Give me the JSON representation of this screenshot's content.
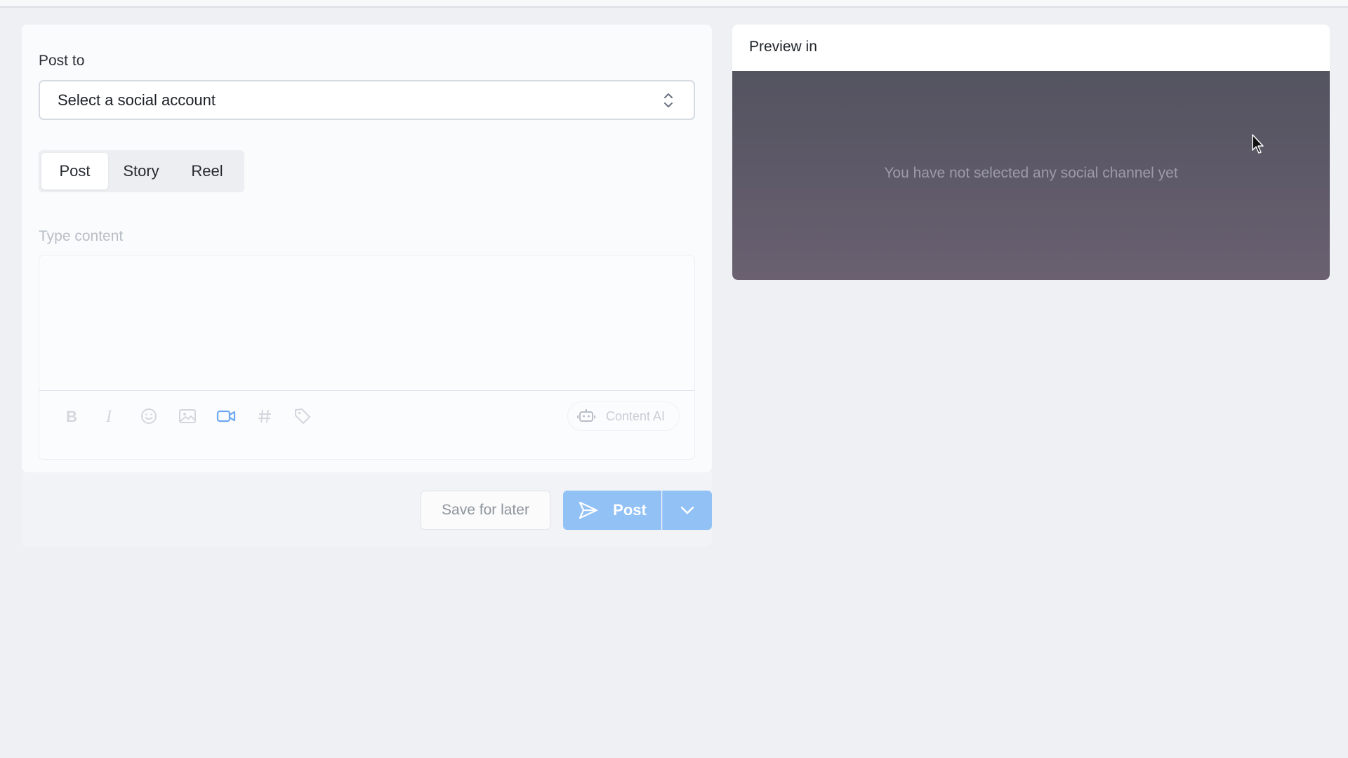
{
  "composer": {
    "post_to_label": "Post to",
    "account_select": {
      "value": "Select a social account",
      "icon": "chevron-up-down-icon"
    },
    "tabs": [
      {
        "label": "Post",
        "active": true
      },
      {
        "label": "Story",
        "active": false
      },
      {
        "label": "Reel",
        "active": false
      }
    ],
    "content_label": "Type content",
    "toolbar": {
      "icons": [
        "bold-icon",
        "italic-icon",
        "emoji-icon",
        "image-icon",
        "video-icon",
        "hashtag-icon",
        "tag-icon"
      ],
      "content_ai_label": "Content AI"
    },
    "actions": {
      "save_label": "Save for later",
      "post_label": "Post"
    }
  },
  "preview": {
    "header": "Preview in",
    "empty_message": "You have not selected any social channel yet"
  },
  "colors": {
    "primary": "#92c1f6",
    "video_icon": "#6ea8f2",
    "preview_bg": "#57555f"
  }
}
